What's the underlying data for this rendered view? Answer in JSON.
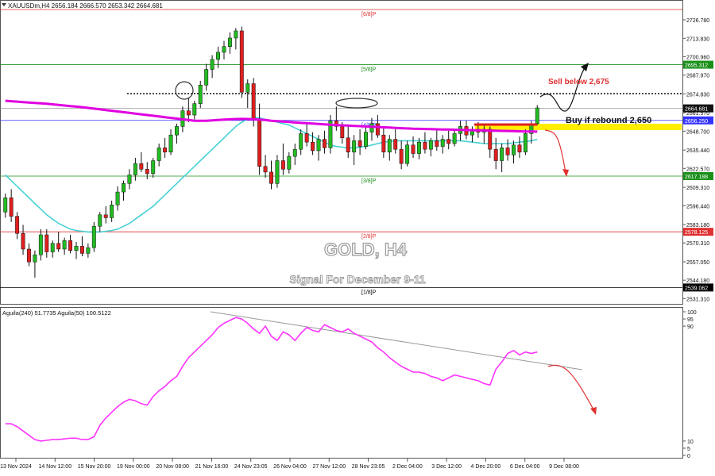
{
  "window": {
    "title": "XAUUSDm,H4  2656.184 2666.570 2653.342 2664.681"
  },
  "main_chart": {
    "watermark_symbol": "GOLD, H4",
    "watermark_signal": "Signal For December 9-11",
    "price_range": [
      2527.6,
      2734.0
    ],
    "price_ticks": [
      "2726.780",
      "2713.830",
      "2700.960",
      "2687.970",
      "2674.830",
      "2661.570",
      "2648.700",
      "2635.440",
      "2622.570",
      "2609.310",
      "2596.440",
      "2583.180",
      "2570.310",
      "2557.050",
      "2544.180",
      "2531.310"
    ],
    "murrey_levels": [
      {
        "label": "[6/8]P",
        "price": 2734.0,
        "color": "#e03030",
        "tag": ""
      },
      {
        "label": "[5/8]P",
        "price": 2695.312,
        "color": "#1a8f1a",
        "tag": "2695.312"
      },
      {
        "label": "[4/8]P",
        "price": 2656.25,
        "color": "#3434ff",
        "tag": "2656.250"
      },
      {
        "label": "[3/8]P",
        "price": 2617.188,
        "color": "#1a8f1a",
        "tag": "2617.188"
      },
      {
        "label": "[2/8]P",
        "price": 2578.125,
        "color": "#e03030",
        "tag": "2578.125"
      },
      {
        "label": "[1/8]P",
        "price": 2539.062,
        "color": "#000000",
        "tag": "2539.062"
      }
    ],
    "current_price": {
      "price": 2664.681,
      "tag": "2664.681"
    },
    "sell_level": {
      "price": 2675.0
    },
    "annotations": {
      "sell_text": "Sell below 2,675",
      "buy_text": "Buy if rebound 2,650"
    },
    "candles": [
      [
        2592.0,
        2605.0,
        2588.0,
        2602.0
      ],
      [
        2602.0,
        2608.0,
        2585.0,
        2589.0
      ],
      [
        2589.0,
        2592.0,
        2573.0,
        2577.0
      ],
      [
        2577.0,
        2583.0,
        2562.0,
        2566.0
      ],
      [
        2566.0,
        2570.0,
        2554.0,
        2557.0
      ],
      [
        2557.0,
        2565.0,
        2546.0,
        2562.0
      ],
      [
        2562.0,
        2580.0,
        2558.0,
        2576.0
      ],
      [
        2576.0,
        2580.0,
        2560.0,
        2564.0
      ],
      [
        2564.0,
        2572.0,
        2560.0,
        2570.0
      ],
      [
        2570.0,
        2578.0,
        2564.0,
        2566.0
      ],
      [
        2566.0,
        2574.0,
        2562.0,
        2572.0
      ],
      [
        2572.0,
        2576.0,
        2563.0,
        2565.0
      ],
      [
        2565.0,
        2571.0,
        2559.0,
        2568.0
      ],
      [
        2568.0,
        2575.0,
        2561.0,
        2563.0
      ],
      [
        2563.0,
        2570.0,
        2560.0,
        2567.0
      ],
      [
        2567.0,
        2585.0,
        2564.0,
        2582.0
      ],
      [
        2582.0,
        2592.0,
        2578.0,
        2590.0
      ],
      [
        2590.0,
        2596.0,
        2584.0,
        2588.0
      ],
      [
        2588.0,
        2600.0,
        2585.0,
        2597.0
      ],
      [
        2597.0,
        2610.0,
        2593.0,
        2606.0
      ],
      [
        2606.0,
        2614.0,
        2600.0,
        2612.0
      ],
      [
        2612.0,
        2622.0,
        2608.0,
        2618.0
      ],
      [
        2618.0,
        2630.0,
        2614.0,
        2626.0
      ],
      [
        2626.0,
        2634.0,
        2620.0,
        2622.0
      ],
      [
        2622.0,
        2627.0,
        2615.0,
        2619.0
      ],
      [
        2619.0,
        2630.0,
        2616.0,
        2628.0
      ],
      [
        2628.0,
        2640.0,
        2624.0,
        2637.0
      ],
      [
        2637.0,
        2644.0,
        2630.0,
        2634.0
      ],
      [
        2634.0,
        2650.0,
        2632.0,
        2646.0
      ],
      [
        2646.0,
        2654.0,
        2640.0,
        2652.0
      ],
      [
        2652.0,
        2666.0,
        2648.0,
        2663.0
      ],
      [
        2663.0,
        2672.0,
        2655.0,
        2660.0
      ],
      [
        2660.0,
        2670.0,
        2657.0,
        2668.0
      ],
      [
        2668.0,
        2684.0,
        2665.0,
        2681.0
      ],
      [
        2681.0,
        2696.0,
        2677.0,
        2692.0
      ],
      [
        2692.0,
        2702.0,
        2686.0,
        2699.0
      ],
      [
        2699.0,
        2708.0,
        2693.0,
        2704.0
      ],
      [
        2704.0,
        2712.0,
        2699.0,
        2708.0
      ],
      [
        2708.0,
        2718.0,
        2703.0,
        2714.0
      ],
      [
        2714.0,
        2721.0,
        2706.0,
        2719.0
      ],
      [
        2719.0,
        2722.0,
        2672.0,
        2676.0
      ],
      [
        2676.0,
        2685.0,
        2665.0,
        2682.0
      ],
      [
        2682.0,
        2686.0,
        2652.0,
        2657.0
      ],
      [
        2657.0,
        2668.0,
        2618.0,
        2624.0
      ],
      [
        2624.0,
        2632.0,
        2616.0,
        2620.0
      ],
      [
        2620.0,
        2628.0,
        2608.0,
        2612.0
      ],
      [
        2612.0,
        2632.0,
        2609.0,
        2628.0
      ],
      [
        2628.0,
        2640.0,
        2618.0,
        2622.0
      ],
      [
        2622.0,
        2634.0,
        2619.0,
        2631.0
      ],
      [
        2631.0,
        2640.0,
        2625.0,
        2636.0
      ],
      [
        2636.0,
        2650.0,
        2632.0,
        2647.0
      ],
      [
        2647.0,
        2654.0,
        2638.0,
        2641.0
      ],
      [
        2641.0,
        2648.0,
        2632.0,
        2635.0
      ],
      [
        2635.0,
        2646.0,
        2628.0,
        2643.0
      ],
      [
        2643.0,
        2649.0,
        2633.0,
        2637.0
      ],
      [
        2637.0,
        2660.0,
        2633.0,
        2656.0
      ],
      [
        2656.0,
        2666.0,
        2649.0,
        2652.0
      ],
      [
        2652.0,
        2655.0,
        2640.0,
        2644.0
      ],
      [
        2644.0,
        2652.0,
        2630.0,
        2634.0
      ],
      [
        2634.0,
        2646.0,
        2625.0,
        2642.0
      ],
      [
        2642.0,
        2650.0,
        2632.0,
        2638.0
      ],
      [
        2638.0,
        2652.0,
        2636.0,
        2648.0
      ],
      [
        2648.0,
        2658.0,
        2642.0,
        2654.0
      ],
      [
        2654.0,
        2660.0,
        2644.0,
        2646.0
      ],
      [
        2646.0,
        2652.0,
        2630.0,
        2634.0
      ],
      [
        2634.0,
        2646.0,
        2628.0,
        2643.0
      ],
      [
        2643.0,
        2650.0,
        2633.0,
        2636.0
      ],
      [
        2636.0,
        2642.0,
        2622.0,
        2626.0
      ],
      [
        2626.0,
        2642.0,
        2624.0,
        2639.0
      ],
      [
        2639.0,
        2645.0,
        2630.0,
        2633.0
      ],
      [
        2633.0,
        2644.0,
        2629.0,
        2641.0
      ],
      [
        2641.0,
        2648.0,
        2633.0,
        2636.0
      ],
      [
        2636.0,
        2644.0,
        2631.0,
        2642.0
      ],
      [
        2642.0,
        2650.0,
        2635.0,
        2638.0
      ],
      [
        2638.0,
        2646.0,
        2633.0,
        2643.0
      ],
      [
        2643.0,
        2649.0,
        2636.0,
        2640.0
      ],
      [
        2640.0,
        2650.0,
        2638.0,
        2647.0
      ],
      [
        2647.0,
        2656.0,
        2642.0,
        2652.0
      ],
      [
        2652.0,
        2656.0,
        2643.0,
        2646.0
      ],
      [
        2646.0,
        2652.0,
        2641.0,
        2650.0
      ],
      [
        2650.0,
        2655.0,
        2644.0,
        2648.0
      ],
      [
        2648.0,
        2653.0,
        2640.0,
        2650.0
      ],
      [
        2650.0,
        2652.0,
        2630.0,
        2636.0
      ],
      [
        2636.0,
        2644.0,
        2622.0,
        2628.0
      ],
      [
        2628.0,
        2640.0,
        2620.0,
        2637.0
      ],
      [
        2637.0,
        2643.0,
        2628.0,
        2632.0
      ],
      [
        2632.0,
        2642.0,
        2626.0,
        2639.0
      ],
      [
        2639.0,
        2645.0,
        2630.0,
        2634.0
      ],
      [
        2634.0,
        2650.0,
        2632.0,
        2647.0
      ],
      [
        2647.0,
        2656.0,
        2640.0,
        2654.0
      ],
      [
        2654.0,
        2667.0,
        2653.0,
        2665.0
      ]
    ],
    "ma_pink_240": [
      2670.0,
      2669.7,
      2669.4,
      2669.1,
      2668.8,
      2668.5,
      2668.2,
      2667.9,
      2667.5,
      2667.1,
      2666.7,
      2666.3,
      2665.9,
      2665.5,
      2665.0,
      2664.5,
      2664.0,
      2663.5,
      2663.0,
      2662.5,
      2662.0,
      2661.5,
      2661.0,
      2660.5,
      2660.0,
      2659.5,
      2659.0,
      2658.5,
      2658.0,
      2657.5,
      2657.0,
      2656.5,
      2656.0,
      2656.0,
      2656.0,
      2656.2,
      2656.5,
      2656.8,
      2657.0,
      2657.2,
      2657.3,
      2657.2,
      2657.0,
      2656.8,
      2656.5,
      2656.0,
      2655.7,
      2655.4,
      2655.1,
      2654.8,
      2654.5,
      2654.3,
      2654.0,
      2653.8,
      2653.5,
      2653.2,
      2653.0,
      2652.8,
      2652.6,
      2652.4,
      2652.2,
      2652.0,
      2651.8,
      2651.6,
      2651.4,
      2651.2,
      2651.0,
      2650.8,
      2650.6,
      2650.4,
      2650.3,
      2650.2,
      2650.1,
      2650.0,
      2649.9,
      2649.8,
      2649.7,
      2649.6,
      2649.5,
      2649.4,
      2649.3,
      2649.2,
      2649.1,
      2649.0,
      2648.9,
      2648.8,
      2648.7,
      2648.6,
      2648.5,
      2648.5,
      2648.4
    ],
    "ma_cyan_50": [
      2618.0,
      2614.0,
      2610.0,
      2606.0,
      2602.0,
      2598.0,
      2594.0,
      2590.0,
      2587.0,
      2584.0,
      2582.0,
      2580.0,
      2579.0,
      2578.5,
      2578.0,
      2578.0,
      2578.0,
      2578.5,
      2579.0,
      2580.0,
      2582.0,
      2584.0,
      2587.0,
      2590.0,
      2593.0,
      2596.0,
      2600.0,
      2604.0,
      2608.0,
      2612.0,
      2616.0,
      2620.0,
      2624.0,
      2628.0,
      2632.0,
      2636.0,
      2640.0,
      2644.0,
      2648.0,
      2652.0,
      2655.0,
      2657.0,
      2658.0,
      2658.0,
      2657.0,
      2656.0,
      2655.0,
      2654.0,
      2653.0,
      2651.0,
      2649.0,
      2647.0,
      2645.0,
      2643.0,
      2641.0,
      2639.0,
      2638.0,
      2637.5,
      2637.0,
      2637.0,
      2637.5,
      2638.0,
      2639.0,
      2640.0,
      2641.0,
      2641.5,
      2642.0,
      2642.0,
      2642.0,
      2642.0,
      2642.0,
      2642.0,
      2642.0,
      2642.0,
      2642.0,
      2642.0,
      2642.0,
      2642.0,
      2641.5,
      2641.0,
      2640.5,
      2640.0,
      2640.0,
      2640.0,
      2640.0,
      2640.0,
      2640.5,
      2641.0,
      2641.5,
      2642.0,
      2643.0
    ]
  },
  "oscillator": {
    "label": "Aguila(240) 51.7735  Aguila(50) 100.5122",
    "range": [
      0,
      100
    ],
    "ticks": [
      "100",
      "95",
      "90",
      "10",
      "5",
      "0"
    ],
    "values": [
      22.0,
      22.0,
      20.0,
      17.0,
      14.0,
      11.0,
      10.0,
      10.5,
      11.0,
      11.0,
      11.5,
      12.0,
      12.0,
      11.0,
      11.0,
      13.0,
      21.0,
      26.0,
      30.0,
      34.0,
      37.0,
      39.0,
      38.0,
      36.0,
      35.0,
      41.0,
      45.0,
      48.0,
      52.0,
      55.0,
      62.0,
      68.0,
      72.0,
      76.0,
      80.0,
      84.0,
      89.0,
      92.0,
      94.0,
      96.0,
      95.0,
      92.0,
      88.0,
      85.0,
      90.0,
      83.0,
      80.0,
      86.0,
      84.0,
      80.0,
      85.0,
      89.0,
      87.0,
      86.0,
      91.0,
      89.0,
      87.0,
      86.0,
      88.0,
      85.0,
      83.0,
      81.0,
      79.0,
      75.0,
      72.0,
      68.0,
      65.0,
      62.0,
      60.0,
      58.0,
      58.0,
      57.0,
      55.0,
      54.0,
      52.0,
      54.0,
      56.0,
      55.0,
      54.0,
      53.0,
      52.0,
      50.0,
      49.0,
      60.0,
      65.0,
      71.0,
      73.0,
      70.0,
      72.0,
      71.0,
      72.0
    ]
  },
  "time_axis": {
    "labels": [
      "13 Nov 2024",
      "14 Nov 12:00",
      "15 Nov 20:00",
      "19 Nov 00:00",
      "20 Nov 08:00",
      "21 Nov 16:00",
      "24 Nov 23:05",
      "26 Nov 04:00",
      "27 Nov 12:00",
      "28 Nov 23:05",
      "2 Dec 04:00",
      "3 Dec 12:00",
      "4 Dec 20:00",
      "6 Dec 04:00",
      "9 Dec 08:00"
    ]
  },
  "colors": {
    "bull": "#22bb22",
    "bear": "#e01f1f",
    "ma_slow": "#e000e0",
    "ma_fast": "#46d1d6",
    "osc": "#ff33ff",
    "buy_zone": "#ffee00",
    "sell_arrow": "#e03030"
  }
}
